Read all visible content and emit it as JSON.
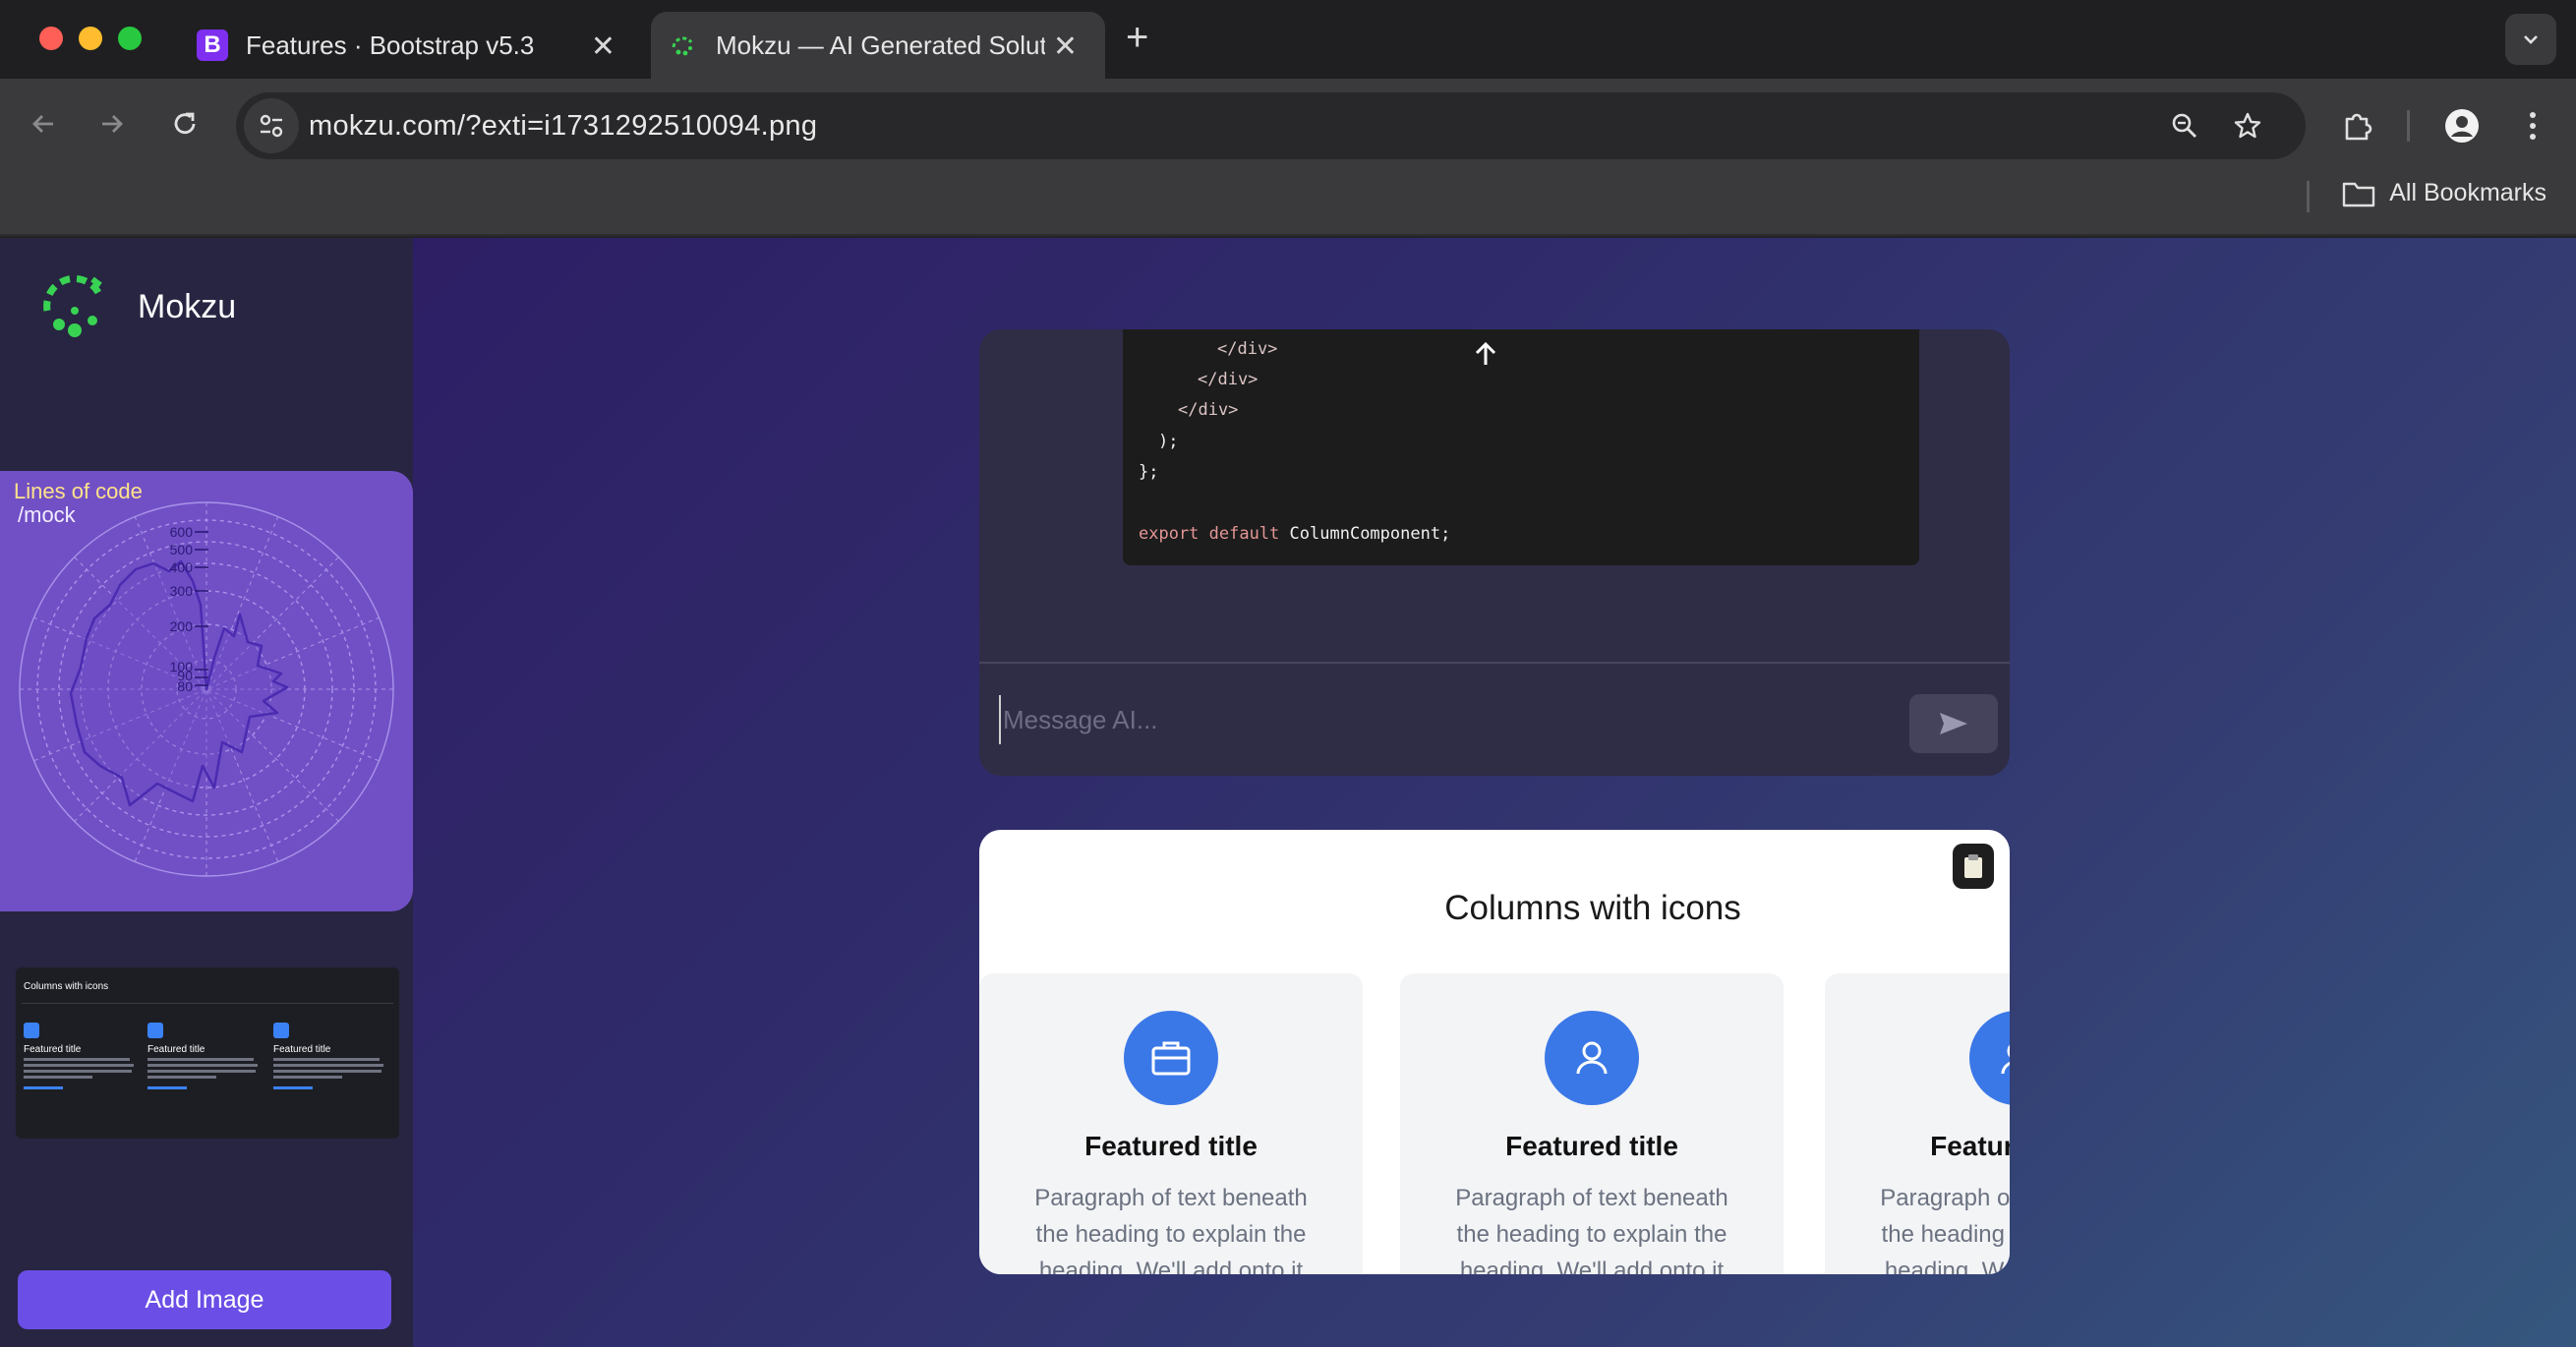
{
  "browser": {
    "tabs": [
      {
        "title": "Features · Bootstrap v5.3",
        "favicon_letter": "B",
        "active": false
      },
      {
        "title": "Mokzu — AI Generated Solutions",
        "active": true
      }
    ],
    "url": "mokzu.com/?exti=i1731292510094.png",
    "bookmarks_label": "All Bookmarks"
  },
  "sidebar": {
    "brand_name": "Mokzu",
    "chart_thumb": {
      "caption_line1": "Lines of code",
      "caption_line2": "/mock",
      "tick_labels": [
        "600",
        "500",
        "400",
        "300",
        "200",
        "100",
        "90",
        "80"
      ]
    },
    "columns_thumb": {
      "title": "Columns with icons",
      "features": [
        {
          "title": "Featured title"
        },
        {
          "title": "Featured title"
        },
        {
          "title": "Featured title"
        }
      ]
    },
    "add_image_label": "Add Image"
  },
  "chat": {
    "code_lines": [
      {
        "text": "</div>",
        "kind": "tag"
      },
      {
        "text": "</div>",
        "kind": "tag"
      },
      {
        "text": "</div>",
        "kind": "tag"
      },
      {
        "text": ");",
        "kind": "plain"
      },
      {
        "text": "};",
        "kind": "plain"
      },
      {
        "text": "",
        "kind": "plain"
      },
      {
        "keyword": "export default",
        "text": "ColumnComponent;",
        "kind": "export"
      }
    ],
    "input_placeholder": "Message AI..."
  },
  "preview": {
    "title": "Columns with icons",
    "features": [
      {
        "icon": "briefcase-icon",
        "title": "Featured title",
        "paragraph": "Paragraph of text beneath the heading to explain the heading. We'll add onto it"
      },
      {
        "icon": "person-icon",
        "title": "Featured title",
        "paragraph": "Paragraph of text beneath the heading to explain the heading. We'll add onto it"
      },
      {
        "icon": "person-icon",
        "title": "Featured title",
        "paragraph": "Paragraph of text beneath the heading to explain the heading. We'll add onto it"
      }
    ]
  },
  "colors": {
    "accent": "#6b4ee6",
    "feature_icon_bg": "#3b78e7",
    "logo_green": "#39d353"
  }
}
